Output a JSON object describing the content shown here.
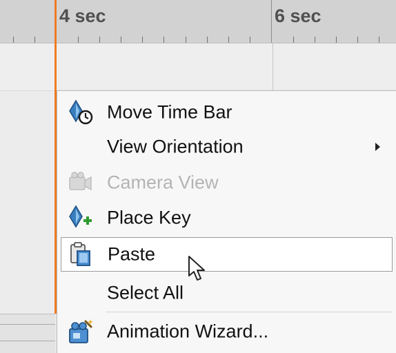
{
  "timeline": {
    "ruler": {
      "labels": [
        "4 sec",
        "6 sec"
      ]
    }
  },
  "context_menu": {
    "items": [
      {
        "label": "Move Time Bar",
        "icon": "move-time-bar-icon",
        "enabled": true
      },
      {
        "label": "View Orientation",
        "icon": "",
        "enabled": true,
        "has_submenu": true
      },
      {
        "label": "Camera View",
        "icon": "camera-icon",
        "enabled": false
      },
      {
        "label": "Place Key",
        "icon": "place-key-icon",
        "enabled": true
      },
      {
        "label": "Paste",
        "icon": "paste-icon",
        "enabled": true,
        "highlighted": true
      },
      {
        "label": "Select All",
        "icon": "",
        "enabled": true
      },
      {
        "label": "Animation Wizard...",
        "icon": "animation-wizard-icon",
        "enabled": true
      }
    ]
  },
  "colors": {
    "time_bar": "#f07b22",
    "menu_background": "#f7f7f7",
    "highlight_background": "#ffffff",
    "disabled_text": "#b4b4b4"
  }
}
